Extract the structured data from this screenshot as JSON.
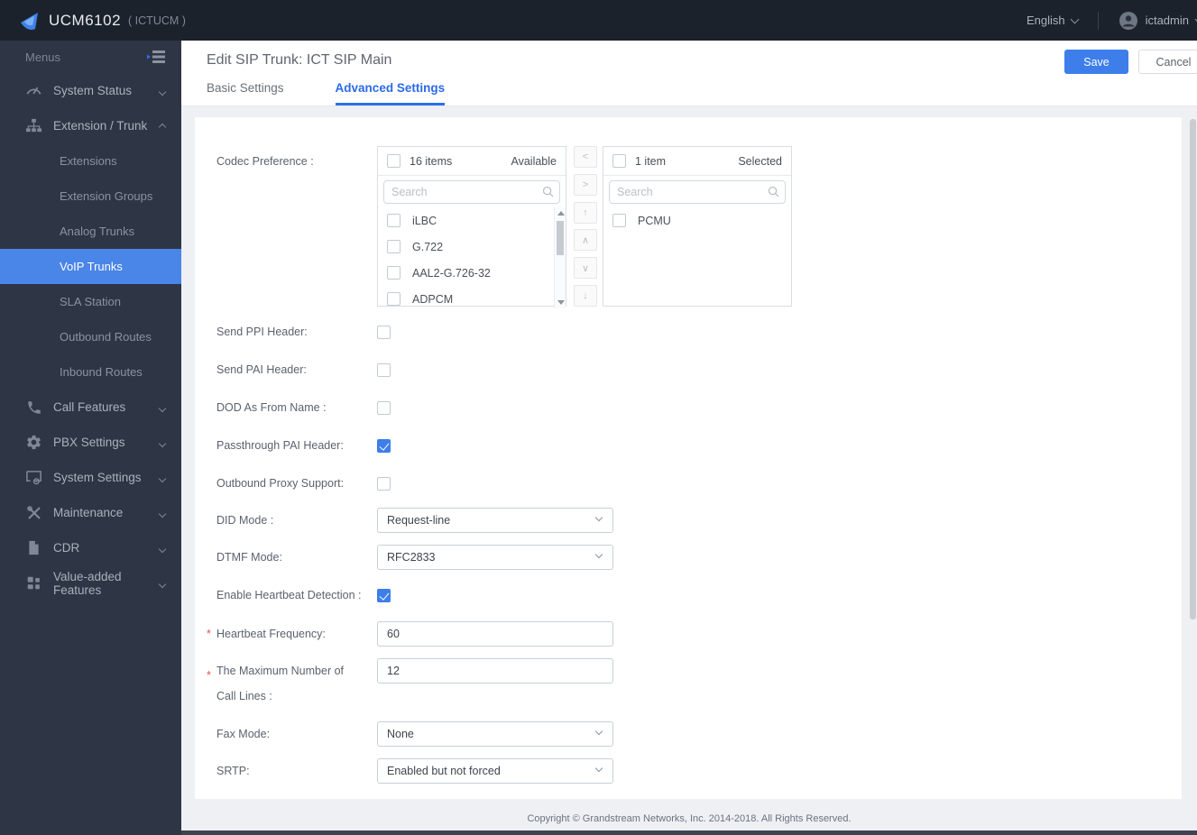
{
  "topbar": {
    "brand": "UCM6102",
    "brand_suffix": "( ICTUCM )",
    "language": "English",
    "user": "ictadmin"
  },
  "sidebar": {
    "menus_label": "Menus",
    "items": [
      {
        "label": "System Status",
        "icon": "gauge",
        "state": "collapsed"
      },
      {
        "label": "Extension / Trunk",
        "icon": "sitemap",
        "state": "expanded"
      },
      {
        "label": "Call Features",
        "icon": "phone",
        "state": "collapsed"
      },
      {
        "label": "PBX Settings",
        "icon": "gear",
        "state": "collapsed"
      },
      {
        "label": "System Settings",
        "icon": "monitor-gear",
        "state": "collapsed"
      },
      {
        "label": "Maintenance",
        "icon": "tools",
        "state": "collapsed"
      },
      {
        "label": "CDR",
        "icon": "document",
        "state": "collapsed"
      },
      {
        "label": "Value-added Features",
        "icon": "grid",
        "state": "collapsed"
      }
    ],
    "submenu": [
      {
        "label": "Extensions",
        "selected": false
      },
      {
        "label": "Extension Groups",
        "selected": false
      },
      {
        "label": "Analog Trunks",
        "selected": false
      },
      {
        "label": "VoIP Trunks",
        "selected": true
      },
      {
        "label": "SLA Station",
        "selected": false
      },
      {
        "label": "Outbound Routes",
        "selected": false
      },
      {
        "label": "Inbound Routes",
        "selected": false
      }
    ]
  },
  "header": {
    "title": "Edit SIP Trunk: ICT SIP Main",
    "save_label": "Save",
    "cancel_label": "Cancel",
    "tabs": [
      {
        "label": "Basic Settings",
        "active": false
      },
      {
        "label": "Advanced Settings",
        "active": true
      }
    ]
  },
  "form": {
    "codec": {
      "label": "Codec Preference :",
      "available": {
        "count_label": "16 items",
        "title": "Available",
        "search_placeholder": "Search",
        "items": [
          "iLBC",
          "G.722",
          "AAL2-G.726-32",
          "ADPCM"
        ]
      },
      "selected": {
        "count_label": "1 item",
        "title": "Selected",
        "search_placeholder": "Search",
        "items": [
          "PCMU"
        ]
      },
      "transfer_buttons": [
        "<",
        ">",
        "↑",
        "∧",
        "∨",
        "↓"
      ]
    },
    "checkboxes": [
      {
        "label": "Send PPI Header:",
        "checked": false
      },
      {
        "label": "Send PAI Header:",
        "checked": false
      },
      {
        "label": "DOD As From Name :",
        "checked": false
      },
      {
        "label": "Passthrough PAI Header:",
        "checked": true
      },
      {
        "label": "Outbound Proxy Support:",
        "checked": false
      }
    ],
    "did_mode": {
      "label": "DID Mode :",
      "value": "Request-line"
    },
    "dtmf_mode": {
      "label": "DTMF Mode:",
      "value": "RFC2833"
    },
    "heartbeat_detection": {
      "label": "Enable Heartbeat Detection :",
      "checked": true
    },
    "heartbeat_frequency": {
      "label": "Heartbeat Frequency:",
      "value": "60",
      "required": "*"
    },
    "max_call_lines": {
      "label": "The Maximum Number of Call Lines :",
      "value": "12",
      "required": "*"
    },
    "fax_mode": {
      "label": "Fax Mode:",
      "value": "None"
    },
    "srtp": {
      "label": "SRTP:",
      "value": "Enabled but not forced"
    }
  },
  "footer": {
    "copyright": "Copyright © Grandstream Networks, Inc. 2014-2018. All Rights Reserved."
  },
  "colors": {
    "accent": "#4a85e8",
    "topbar_bg": "#1c222c",
    "sidebar_bg": "#2e3544",
    "save_bg": "#3d7eea"
  }
}
